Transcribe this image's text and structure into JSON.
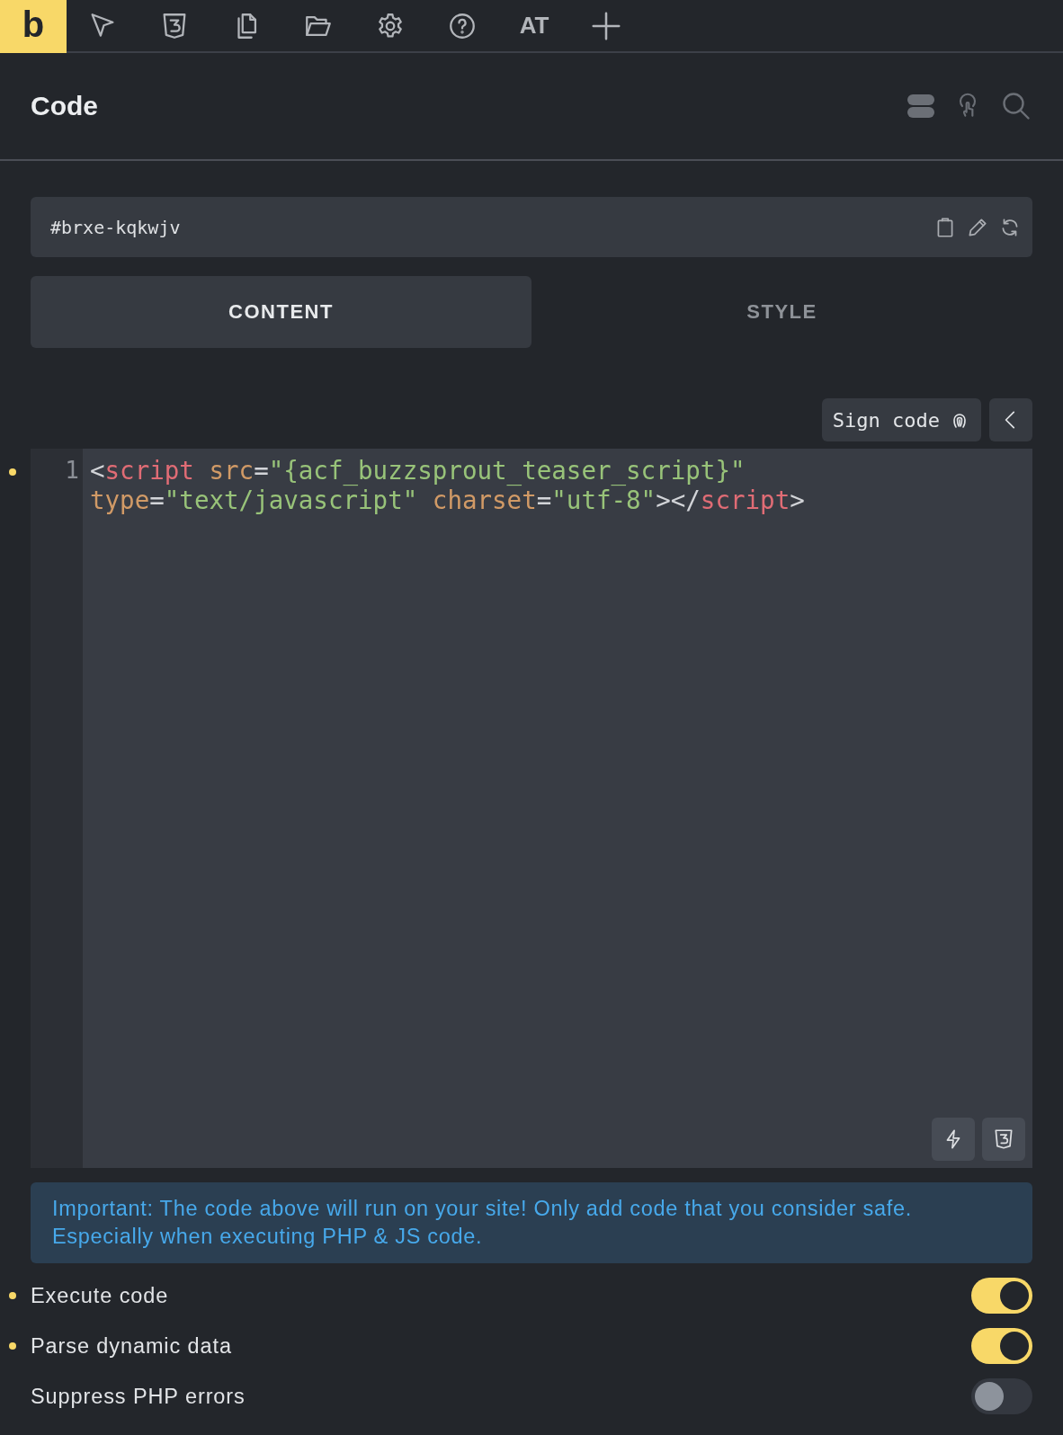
{
  "toolbar": {
    "logo": "b",
    "text_button": "AT"
  },
  "header": {
    "title": "Code"
  },
  "element_id": {
    "value": "#brxe-kqkwjv"
  },
  "tabs": [
    {
      "label": "CONTENT",
      "selected": true
    },
    {
      "label": "STYLE",
      "selected": false
    }
  ],
  "sign_button": "Sign code",
  "editor": {
    "modified": true,
    "line_number": "1",
    "tokens": [
      {
        "kind": "punct",
        "text": "<"
      },
      {
        "kind": "tag",
        "text": "script"
      },
      {
        "kind": "attr",
        "text": " src"
      },
      {
        "kind": "punct",
        "text": "="
      },
      {
        "kind": "string",
        "text": "\"{acf_buzzsprout_teaser_script}\""
      },
      {
        "kind": "attr",
        "text": " type"
      },
      {
        "kind": "punct",
        "text": "="
      },
      {
        "kind": "string",
        "text": "\"text/javascript\""
      },
      {
        "kind": "attr",
        "text": " charset"
      },
      {
        "kind": "punct",
        "text": "="
      },
      {
        "kind": "string",
        "text": "\"utf-8\""
      },
      {
        "kind": "punct",
        "text": "></"
      },
      {
        "kind": "tag",
        "text": "script"
      },
      {
        "kind": "punct",
        "text": ">"
      }
    ]
  },
  "notice": "Important: The code above will run on your site! Only add code that you consider safe. Especially when executing PHP & JS code.",
  "settings": [
    {
      "label": "Execute code",
      "modified": true,
      "on": true
    },
    {
      "label": "Parse dynamic data",
      "modified": true,
      "on": true
    },
    {
      "label": "Suppress PHP errors",
      "modified": false,
      "on": false
    }
  ]
}
